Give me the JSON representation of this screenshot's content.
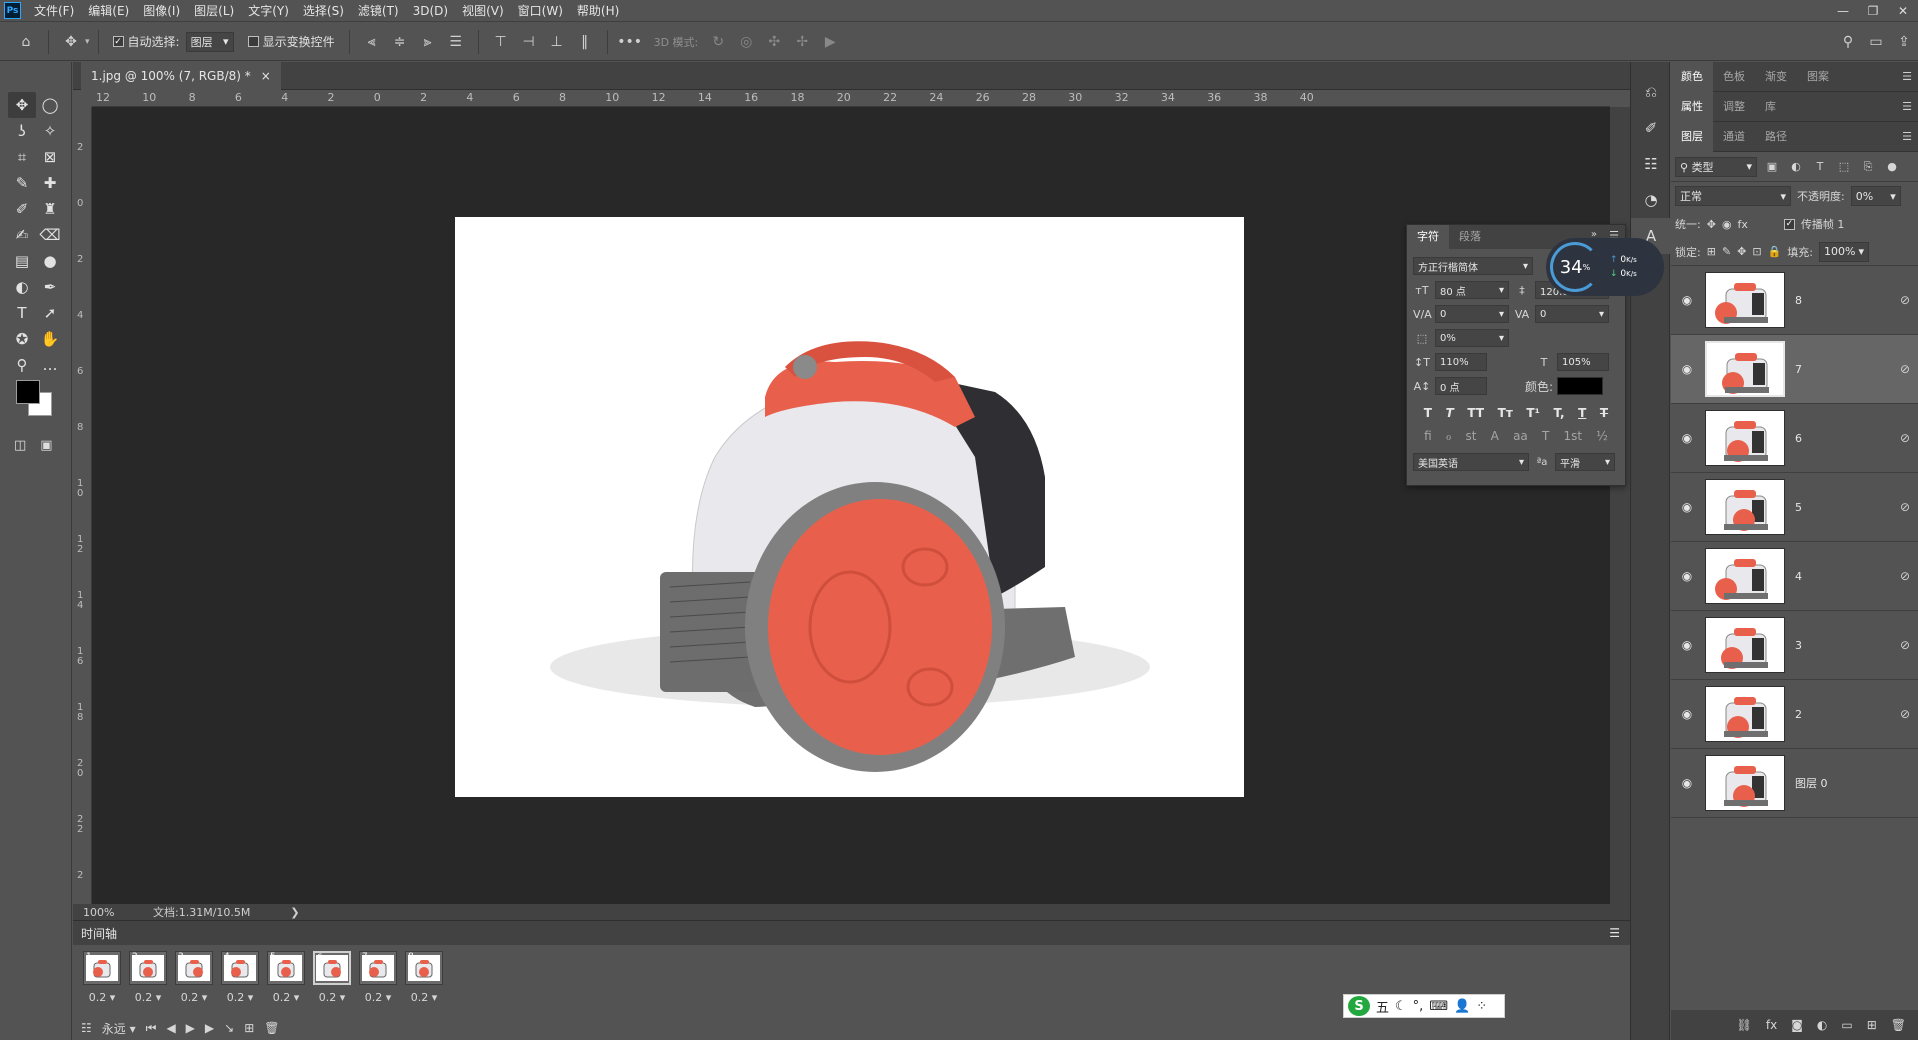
{
  "app": {
    "logo": "Ps"
  },
  "menu": [
    "文件(F)",
    "编辑(E)",
    "图像(I)",
    "图层(L)",
    "文字(Y)",
    "选择(S)",
    "滤镜(T)",
    "3D(D)",
    "视图(V)",
    "窗口(W)",
    "帮助(H)"
  ],
  "window_controls": {
    "minimize": "—",
    "restore": "❐",
    "close": "✕"
  },
  "options_bar": {
    "auto_select_label": "自动选择:",
    "auto_select_target": "图层",
    "show_transform_label": "显示变换控件",
    "mode_3d_label": "3D 模式:",
    "more": "•••"
  },
  "document": {
    "tab_title": "1.jpg @ 100% (7, RGB/8) *",
    "close_glyph": "×"
  },
  "rulers": {
    "top": [
      "12",
      "10",
      "8",
      "6",
      "4",
      "2",
      "0",
      "2",
      "4",
      "6",
      "8",
      "10",
      "12",
      "14",
      "16",
      "18",
      "20",
      "22",
      "24",
      "26",
      "28",
      "30",
      "32",
      "34",
      "36",
      "38",
      "40"
    ],
    "left": [
      "4",
      "2",
      "0",
      "2",
      "4",
      "6",
      "8",
      "1 0",
      "1 2",
      "1 4",
      "1 6",
      "1 8",
      "2 0",
      "2 2",
      "2"
    ]
  },
  "status": {
    "zoom": "100%",
    "doc_info": "文档:1.31M/10.5M",
    "arrow": "❯"
  },
  "timeline": {
    "title": "时间轴",
    "frames": [
      {
        "num": "1",
        "delay": "0.2"
      },
      {
        "num": "2",
        "delay": "0.2"
      },
      {
        "num": "3",
        "delay": "0.2"
      },
      {
        "num": "4",
        "delay": "0.2"
      },
      {
        "num": "5",
        "delay": "0.2"
      },
      {
        "num": "6",
        "delay": "0.2"
      },
      {
        "num": "7",
        "delay": "0.2"
      },
      {
        "num": "8",
        "delay": "0.2"
      }
    ],
    "loop_label": "永远"
  },
  "char_panel": {
    "tab_character": "字符",
    "tab_paragraph": "段落",
    "font_family": "方正行楷简体",
    "font_size": "80 点",
    "leading": "120.03 点",
    "kerning": "0",
    "tracking": "0",
    "tsume": "0%",
    "vertical_scale": "110%",
    "horizontal_scale": "105%",
    "baseline_shift": "0 点",
    "color_label": "颜色:",
    "text_color": "#000000",
    "language": "美国英语",
    "aa_label": "ªa",
    "antialias": "平滑",
    "style_buttons": [
      "T",
      "T",
      "TT",
      "Tт",
      "T¹",
      "T,",
      "T",
      "T"
    ],
    "opentype_buttons": [
      "fi",
      "ℴ",
      "st",
      "A",
      "aa",
      "T",
      "1st",
      "½"
    ]
  },
  "net_widget": {
    "percent": "34",
    "percent_sign": "%",
    "up": "0",
    "down": "0",
    "unit": "K/s"
  },
  "right_panels": {
    "group1_tabs": [
      "颜色",
      "色板",
      "渐变",
      "图案"
    ],
    "group2_tabs": [
      "属性",
      "调整",
      "库"
    ],
    "group3_tabs": [
      "图层",
      "通道",
      "路径"
    ],
    "filter_kind": "类型",
    "blend_mode": "正常",
    "opacity_label": "不透明度:",
    "opacity": "0%",
    "unify_label": "统一:",
    "propagate_label": "传播帧 1",
    "lock_label": "锁定:",
    "fill_label": "填充:",
    "fill": "100%",
    "layers": [
      {
        "name": "8",
        "selected": false
      },
      {
        "name": "7",
        "selected": true
      },
      {
        "name": "6",
        "selected": false
      },
      {
        "name": "5",
        "selected": false
      },
      {
        "name": "4",
        "selected": false
      },
      {
        "name": "3",
        "selected": false
      },
      {
        "name": "2",
        "selected": false
      },
      {
        "name": "图层 0",
        "selected": false
      }
    ]
  },
  "ime": {
    "logo": "S",
    "mode": "五"
  },
  "colors": {
    "accent_red": "#e8604c",
    "vacuum_white": "#e9e8ec",
    "vacuum_grey": "#6f6f6f"
  }
}
